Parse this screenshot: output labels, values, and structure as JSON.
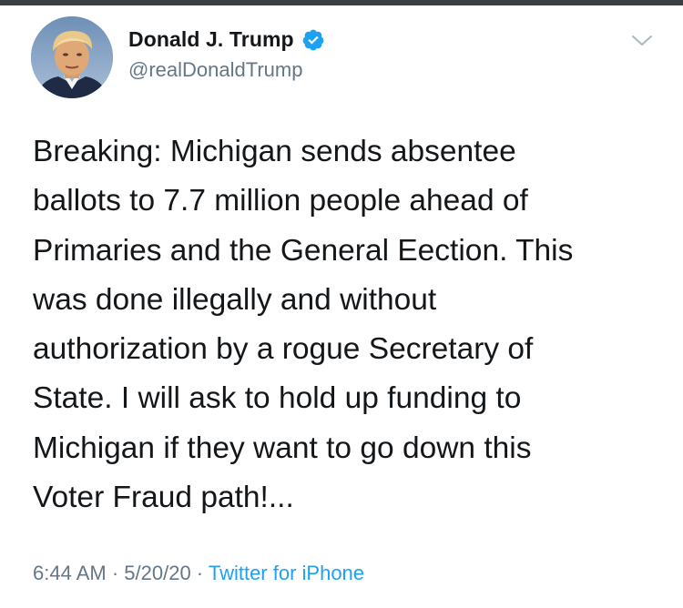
{
  "user": {
    "display_name": "Donald J. Trump",
    "handle": "@realDonaldTrump",
    "verified": true,
    "avatar_icon": "profile-photo"
  },
  "tweet": {
    "lines": [
      "Breaking: Michigan sends absentee",
      "ballots to 7.7 million people ahead of",
      "Primaries and the General Eection. This",
      "was done illegally and without",
      "authorization by a rogue Secretary of",
      "State. I will ask to hold up funding to",
      "Michigan if they want to go down this",
      "Voter Fraud path!..."
    ]
  },
  "meta": {
    "time": "6:44 AM",
    "separator": " · ",
    "date": "5/20/20",
    "source": "Twitter for iPhone"
  },
  "colors": {
    "text": "#14171a",
    "secondary": "#657786",
    "link": "#1da1f2",
    "verified": "#1da1f2"
  },
  "icons": {
    "menu": "chevron-down-icon",
    "verified": "verified-badge-icon"
  }
}
